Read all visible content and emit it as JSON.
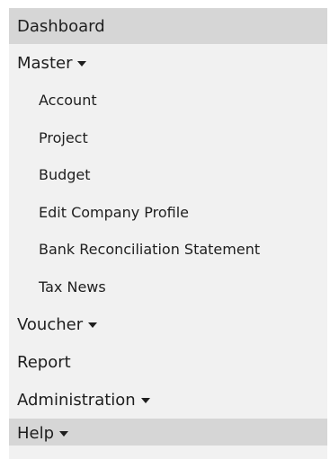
{
  "menu": {
    "dashboard": "Dashboard",
    "master": {
      "label": "Master",
      "icon": "caret-down-icon",
      "items": [
        "Account",
        "Project",
        "Budget",
        "Edit Company Profile",
        "Bank Reconciliation Statement",
        "Tax News"
      ]
    },
    "voucher": {
      "label": "Voucher",
      "icon": "caret-down-icon"
    },
    "report": "Report",
    "administration": {
      "label": "Administration",
      "icon": "caret-down-icon"
    },
    "help": {
      "label": "Help",
      "icon": "caret-down-icon"
    }
  },
  "colors": {
    "menu_background": "#f1f1f1",
    "highlight_background": "#d6d6d6",
    "text": "#1e1e1e"
  }
}
